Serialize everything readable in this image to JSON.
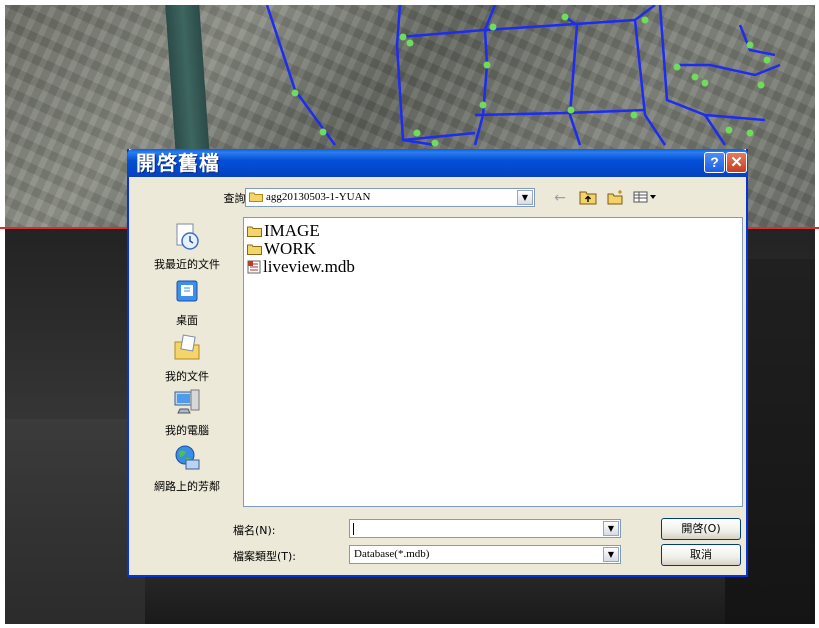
{
  "dialog": {
    "title": "開啓舊檔",
    "help_label": "?",
    "close_label": "✕",
    "look_in_label": "查詢(I):",
    "look_in_value": "agg20130503-1-YUAN",
    "places": [
      {
        "label": "我最近的文件",
        "icon": "recent-documents-icon"
      },
      {
        "label": "桌面",
        "icon": "desktop-icon"
      },
      {
        "label": "我的文件",
        "icon": "my-documents-icon"
      },
      {
        "label": "我的電腦",
        "icon": "my-computer-icon"
      },
      {
        "label": "網路上的芳鄰",
        "icon": "network-places-icon"
      }
    ],
    "files": [
      {
        "name": "IMAGE",
        "type": "folder"
      },
      {
        "name": "WORK",
        "type": "folder"
      },
      {
        "name": "liveview.mdb",
        "type": "mdb"
      }
    ],
    "filename_label": "檔名(N):",
    "filename_value": "",
    "filetype_label": "檔案類型(T):",
    "filetype_value": "Database(*.mdb)",
    "open_label": "開啓(O)",
    "cancel_label": "取消"
  }
}
